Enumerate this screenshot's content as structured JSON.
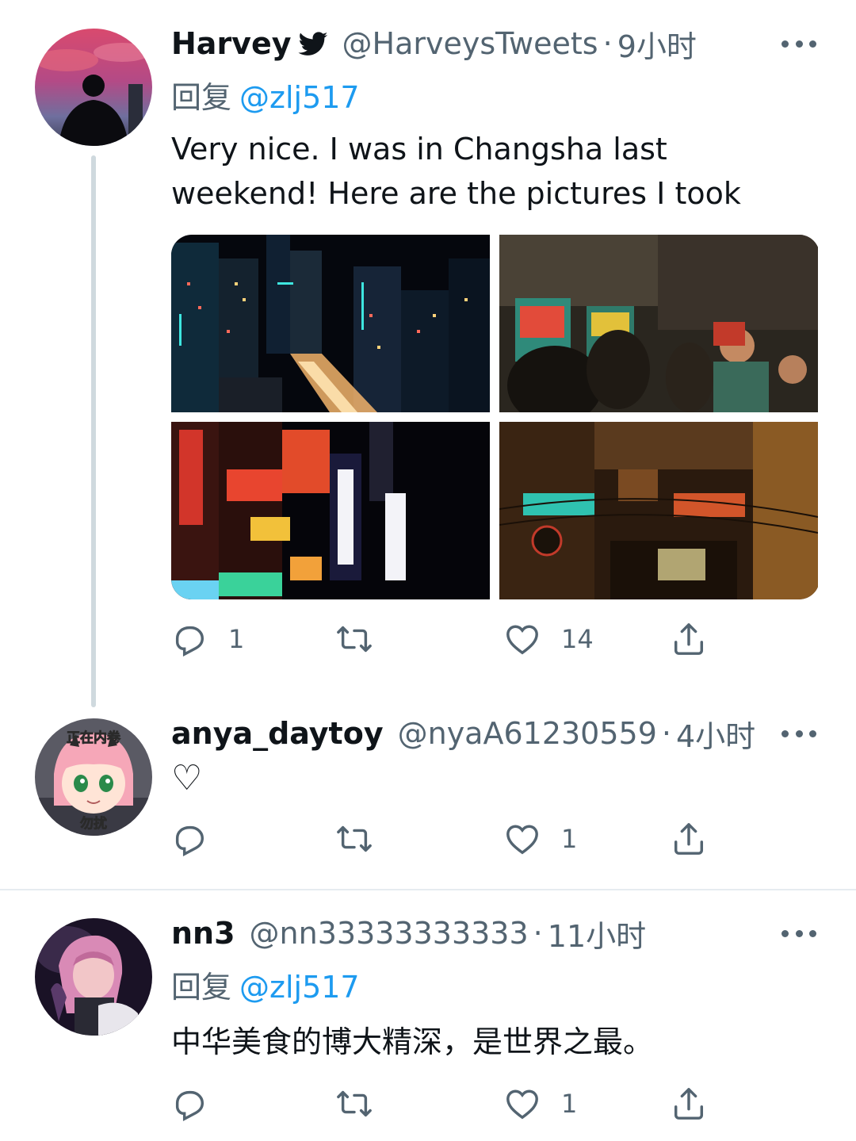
{
  "tweets": [
    {
      "display_name": "Harvey",
      "handle": "@HarveysTweets",
      "separator": "·",
      "time": "9小时",
      "reply_prefix": "回复",
      "reply_to": "@zlj517",
      "text": "Very nice. I was in Changsha last weekend! Here are the pictures I took",
      "media": [
        "city-night-skyline-photo",
        "arcade-crowd-photo",
        "neon-signs-street-photo",
        "old-alley-neon-photo"
      ],
      "counts": {
        "reply": "1",
        "retweet": "",
        "like": "14"
      }
    },
    {
      "display_name": "anya_daytoy",
      "handle": "@nyaA61230559",
      "separator": "·",
      "time": "4小时",
      "text": "♡",
      "avatar_caption_top": "正在内卷",
      "avatar_caption_bottom": "勿扰",
      "counts": {
        "reply": "",
        "retweet": "",
        "like": "1"
      }
    },
    {
      "display_name": "nn3",
      "handle": "@nn33333333333",
      "separator": "·",
      "time": "11小时",
      "reply_prefix": "回复",
      "reply_to": "@zlj517",
      "text": "中华美食的博大精深，是世界之最。",
      "counts": {
        "reply": "",
        "retweet": "",
        "like": "1"
      }
    }
  ],
  "colors": {
    "accent": "#1d9bf0",
    "secondary_text": "#536471",
    "primary_text": "#0f1419",
    "thread_line": "#cfd9de"
  },
  "icons": [
    "verified-bird-icon",
    "more-icon",
    "reply-icon",
    "retweet-icon",
    "like-icon",
    "share-icon"
  ]
}
